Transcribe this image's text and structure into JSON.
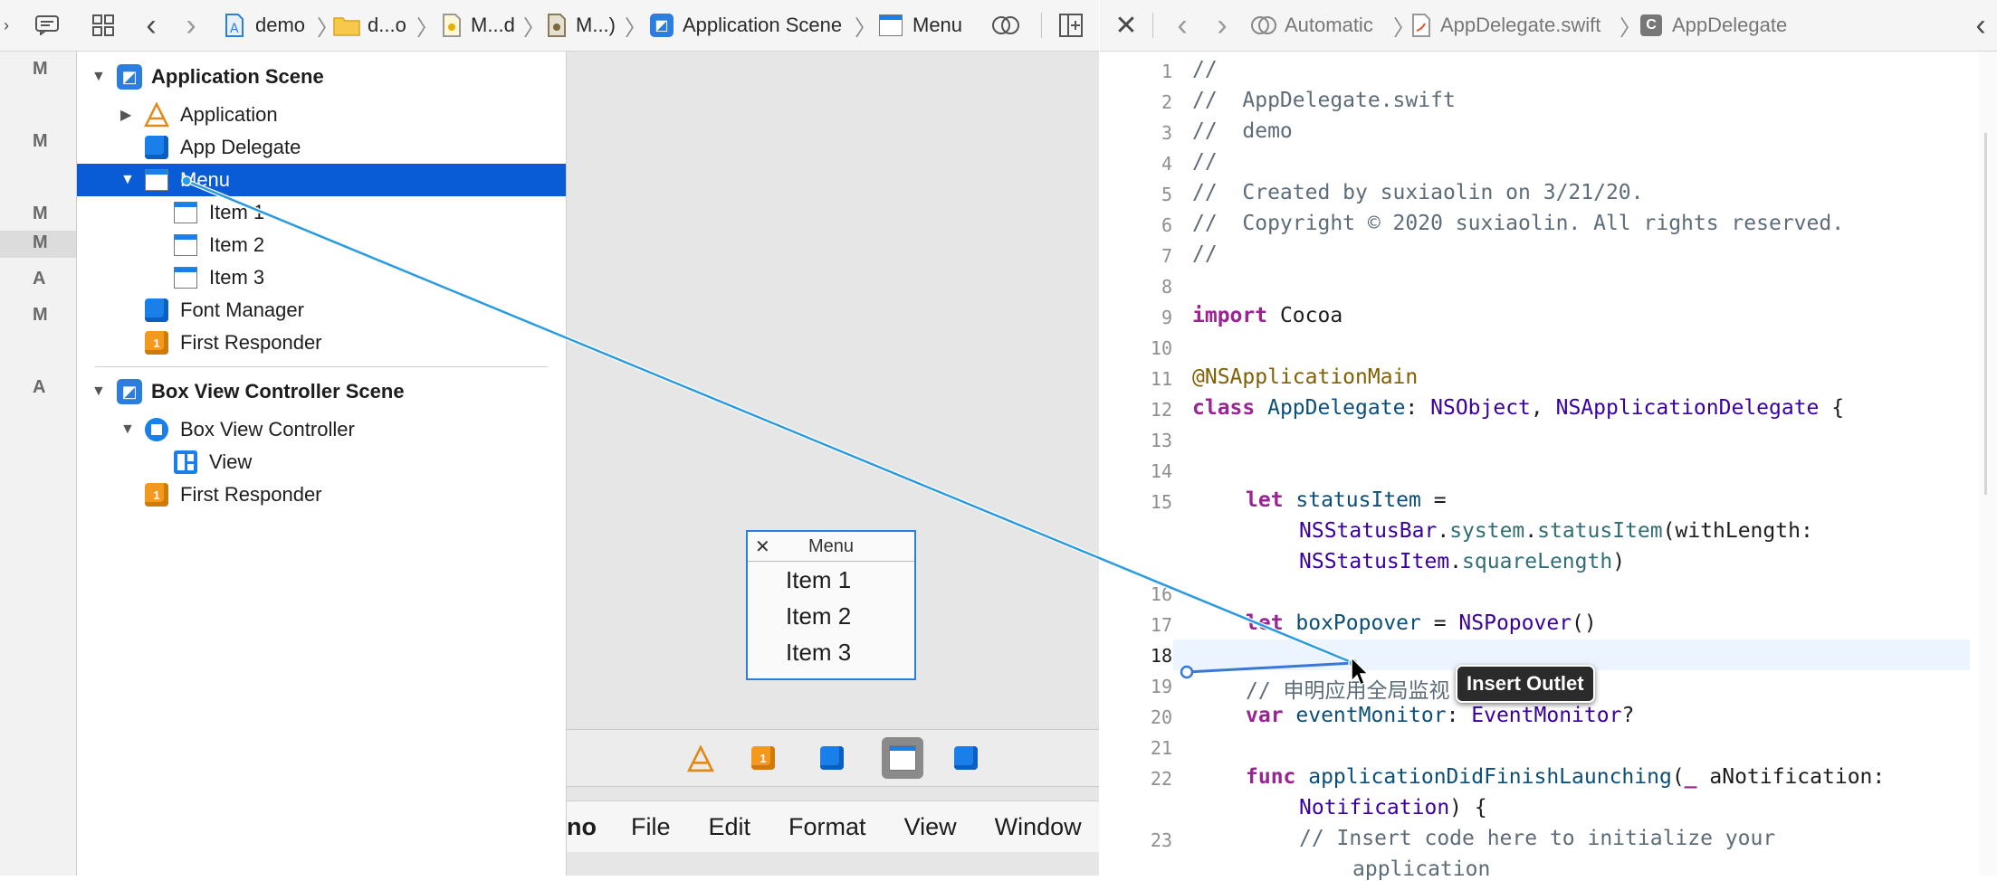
{
  "ib_toolbar": {
    "breadcrumb": [
      "demo",
      "d...o",
      "M...d",
      "M...)",
      "Application Scene",
      "Menu"
    ]
  },
  "code_toolbar": {
    "breadcrumb": [
      "Automatic",
      "AppDelegate.swift",
      "AppDelegate"
    ]
  },
  "left_strip": {
    "letters": [
      "M",
      "M",
      "M",
      "M",
      "A",
      "M",
      "A"
    ]
  },
  "outline": {
    "scene1": {
      "title": "Application Scene",
      "items": [
        "Application",
        "App Delegate",
        "Menu",
        "Item 1",
        "Item 2",
        "Item 3",
        "Font Manager",
        "First Responder"
      ]
    },
    "scene2": {
      "title": "Box View Controller Scene",
      "items": [
        "Box View Controller",
        "View",
        "First Responder"
      ]
    }
  },
  "canvas": {
    "menu_window": {
      "title": "Menu",
      "items": [
        "Item 1",
        "Item 2",
        "Item 3"
      ]
    },
    "menubar": [
      "no",
      "File",
      "Edit",
      "Format",
      "View",
      "Window"
    ]
  },
  "editor": {
    "tooltip": "Insert Outlet",
    "line_numbers": [
      "1",
      "2",
      "3",
      "4",
      "5",
      "6",
      "7",
      "8",
      "9",
      "10",
      "11",
      "12",
      "13",
      "14",
      "15",
      "16",
      "17",
      "18",
      "19",
      "20",
      "21",
      "22",
      "23"
    ],
    "lines": {
      "l1": "//",
      "l2": "//  AppDelegate.swift",
      "l3": "//  demo",
      "l4": "//",
      "l5": "//  Created by suxiaolin on 3/21/20.",
      "l6": "//  Copyright © 2020 suxiaolin. All rights reserved.",
      "l7": "//",
      "l9_kw": "import",
      "l9_rest": " Cocoa",
      "l11": "@NSApplicationMain",
      "l12_kw": "class",
      "l12_name": " AppDelegate",
      "l12_p1": ": ",
      "l12_t1": "NSObject",
      "l12_p2": ", ",
      "l12_t2": "NSApplicationDelegate",
      "l12_p3": " {",
      "l15_kw": "let",
      "l15_name": " statusItem",
      "l15_p": " =",
      "l15b_t": "NSStatusBar",
      "l15b_p1": ".",
      "l15b_f1": "system",
      "l15b_p2": ".",
      "l15b_f2": "statusItem",
      "l15b_p3": "(withLength:",
      "l15c_t": "NSStatusItem",
      "l15c_p1": ".",
      "l15c_f": "squareLength",
      "l15c_p2": ")",
      "l17_kw": "let",
      "l17_name": " boxPopover",
      "l17_p": " = ",
      "l17_t": "NSPopover",
      "l17_p2": "()",
      "l19": "// 申明应用全局监视",
      "l20_kw": "var",
      "l20_name": " eventMonitor",
      "l20_p": ": ",
      "l20_t": "EventMonitor",
      "l20_p2": "?",
      "l22_kw": "func",
      "l22_name": " applicationDidFinishLaunching",
      "l22_p": "(",
      "l22_u": "_",
      "l22_rest": " aNotification:",
      "l22b_t": "Notification",
      "l22b_p": ") {",
      "l23": "// Insert code here to initialize your",
      "l23b": "application"
    }
  },
  "colors": {
    "selection": "#0a5bd6",
    "connection_line": "#2a9be0",
    "keyword": "#9b2393",
    "comment": "#5d6c79",
    "type": "#3900a0"
  }
}
